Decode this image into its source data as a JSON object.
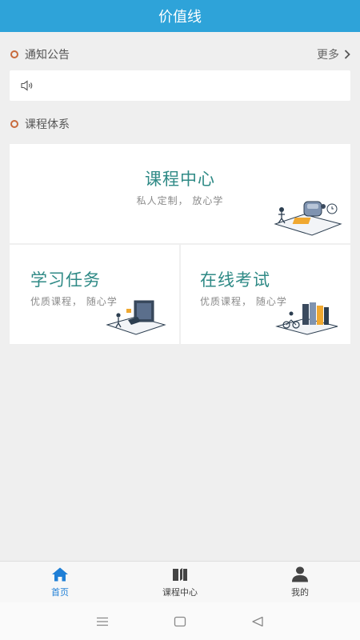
{
  "header": {
    "title": "价值线"
  },
  "notice": {
    "section_title": "通知公告",
    "more_label": "更多",
    "text": ""
  },
  "courses": {
    "section_title": "课程体系",
    "cards": [
      {
        "title": "课程中心",
        "subtitle": "私人定制，  放心学"
      },
      {
        "title": "学习任务",
        "subtitle": "优质课程，  随心学"
      },
      {
        "title": "在线考试",
        "subtitle": "优质课程，  随心学"
      }
    ]
  },
  "tabbar": {
    "items": [
      {
        "label": "首页",
        "icon": "home-icon",
        "active": true
      },
      {
        "label": "课程中心",
        "icon": "book-icon",
        "active": false
      },
      {
        "label": "我的",
        "icon": "user-icon",
        "active": false
      }
    ]
  },
  "system_nav": {
    "icons": [
      "menu-icon",
      "home-square-icon",
      "back-triangle-icon"
    ]
  },
  "colors": {
    "accent": "#2ea3d9",
    "card_title": "#2f8a86",
    "dot": "#c86a3c",
    "tab_active": "#1f7fd6"
  }
}
